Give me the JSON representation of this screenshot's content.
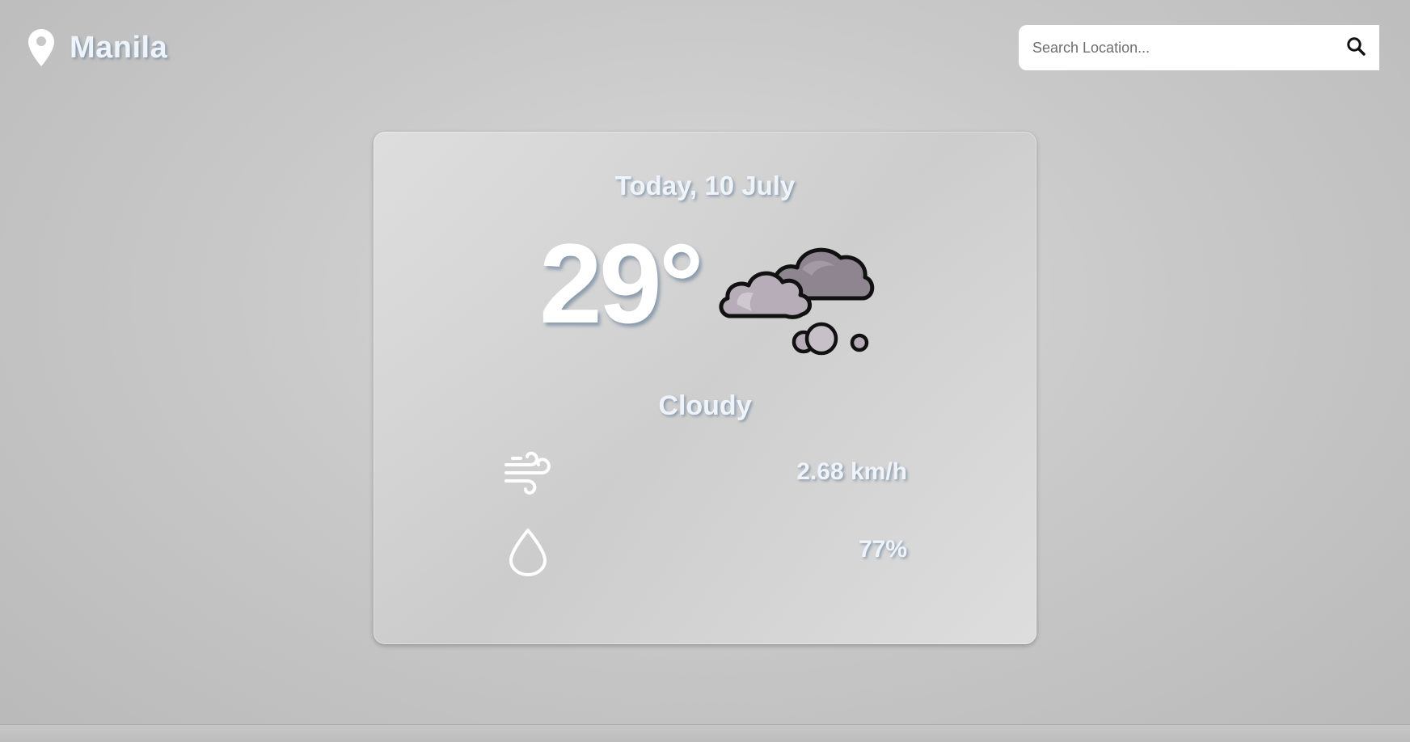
{
  "header": {
    "location_icon": "map-pin-icon",
    "city": "Manila"
  },
  "search": {
    "placeholder": "Search Location...",
    "value": "",
    "icon": "search-icon"
  },
  "weather": {
    "date": "Today, 10 July",
    "temperature": "29°",
    "condition": "Cloudy",
    "condition_icon": "cloudy-icon",
    "wind": {
      "icon": "wind-icon",
      "value": "2.68 km/h"
    },
    "humidity": {
      "icon": "droplet-icon",
      "value": "77%"
    }
  },
  "colors": {
    "text": "#ffffff",
    "text_shadow": "#506e8c",
    "cloud_dark": "#8e8591",
    "cloud_light": "#b6adb8",
    "search_bg": "#ffffff"
  }
}
